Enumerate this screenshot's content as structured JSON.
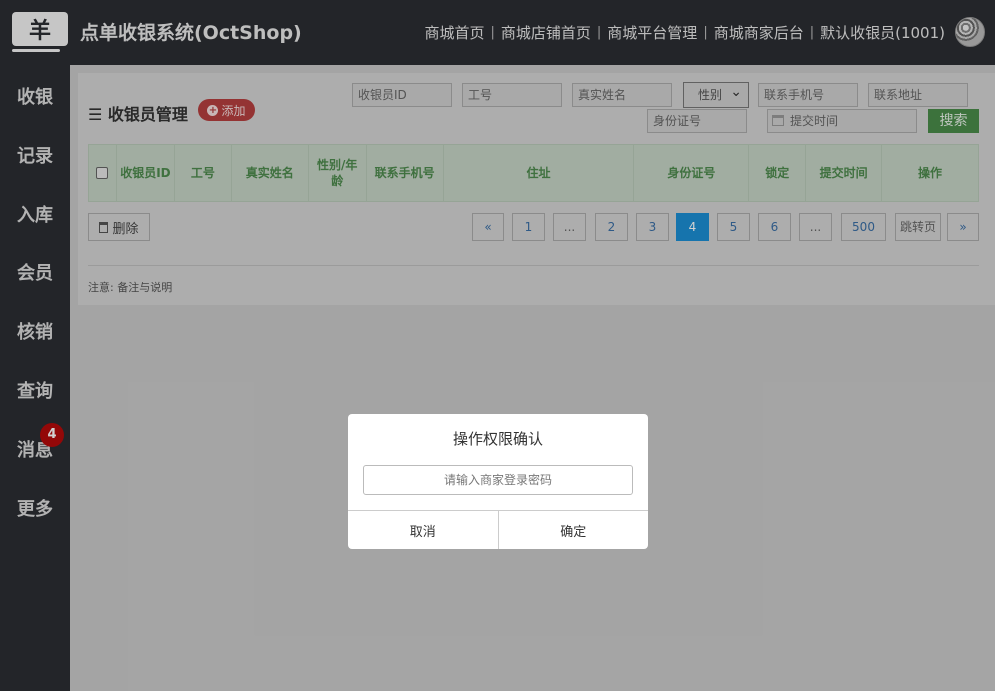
{
  "header": {
    "logo_glyph": "羊",
    "title": "点单收银系统(OctShop)",
    "nav": [
      "商城首页",
      "商城店铺首页",
      "商城平台管理",
      "商城商家后台",
      "默认收银员(1001)"
    ],
    "separator": "|"
  },
  "sidebar": {
    "items": [
      {
        "label": "收银"
      },
      {
        "label": "记录"
      },
      {
        "label": "入库"
      },
      {
        "label": "会员"
      },
      {
        "label": "核销"
      },
      {
        "label": "查询"
      },
      {
        "label": "消息",
        "badge": "4"
      },
      {
        "label": "更多"
      }
    ]
  },
  "page": {
    "title": "收银员管理",
    "add_label": "添加",
    "delete_label": "删除",
    "note": "注意: 备注与说明"
  },
  "filters": {
    "cashier_id": "收银员ID",
    "job_no": "工号",
    "real_name": "真实姓名",
    "gender": "性别",
    "phone": "联系手机号",
    "address": "联系地址",
    "id_card": "身份证号",
    "submit_time": "提交时间",
    "search_label": "搜索"
  },
  "table": {
    "columns": [
      "收银员ID",
      "工号",
      "真实姓名",
      "性别/年龄",
      "联系手机号",
      "住址",
      "身份证号",
      "锁定",
      "提交时间",
      "操作"
    ]
  },
  "pagination": {
    "items": [
      "«",
      "1",
      "...",
      "2",
      "3",
      "4",
      "5",
      "6",
      "...",
      "500",
      "跳转页",
      "»"
    ],
    "current": "4"
  },
  "modal": {
    "title": "操作权限确认",
    "input_placeholder": "请输入商家登录密码",
    "cancel_label": "取消",
    "confirm_label": "确定"
  },
  "colors": {
    "topbar": "#2b2e33",
    "add_button": "#b53f3f",
    "search_button": "#4a8b4a",
    "table_header_text": "#4e8a4e",
    "active_page": "#1b8ed4",
    "badge": "#b40a0a"
  }
}
